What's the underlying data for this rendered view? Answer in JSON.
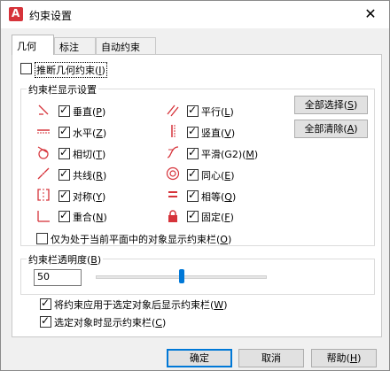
{
  "window": {
    "title": "约束设置",
    "close_glyph": "✕"
  },
  "tabs": [
    {
      "label": "几何",
      "active": true
    },
    {
      "label": "标注",
      "active": false
    },
    {
      "label": "自动约束",
      "active": false
    }
  ],
  "infer": {
    "label": "推断几何约束(",
    "key": "I",
    "tail": ")",
    "checked": false
  },
  "display_group": {
    "title": "约束栏显示设置"
  },
  "constraints_left": [
    {
      "label": "垂直(",
      "key": "P",
      "tail": ")",
      "icon": "perpendicular-icon",
      "checked": true
    },
    {
      "label": "水平(",
      "key": "Z",
      "tail": ")",
      "icon": "horizontal-icon",
      "checked": true
    },
    {
      "label": "相切(",
      "key": "T",
      "tail": ")",
      "icon": "tangent-icon",
      "checked": true
    },
    {
      "label": "共线(",
      "key": "R",
      "tail": ")",
      "icon": "collinear-icon",
      "checked": true
    },
    {
      "label": "对称(",
      "key": "Y",
      "tail": ")",
      "icon": "symmetric-icon",
      "checked": true
    },
    {
      "label": "重合(",
      "key": "N",
      "tail": ")",
      "icon": "coincident-icon",
      "checked": true
    }
  ],
  "constraints_right": [
    {
      "label": "平行(",
      "key": "L",
      "tail": ")",
      "icon": "parallel-icon",
      "checked": true
    },
    {
      "label": "竖直(",
      "key": "V",
      "tail": ")",
      "icon": "vertical-icon",
      "checked": true
    },
    {
      "label": "平滑(G2)(",
      "key": "M",
      "tail": ")",
      "icon": "smooth-icon",
      "checked": true
    },
    {
      "label": "同心(",
      "key": "E",
      "tail": ")",
      "icon": "concentric-icon",
      "checked": true
    },
    {
      "label": "相等(",
      "key": "Q",
      "tail": ")",
      "icon": "equal-icon",
      "checked": true
    },
    {
      "label": "固定(",
      "key": "F",
      "tail": ")",
      "icon": "fix-lock-icon",
      "checked": true
    }
  ],
  "buttons_side": {
    "select_all": "全部选择(",
    "select_all_key": "S",
    "clear_all": "全部清除(",
    "clear_all_key": "A",
    "tail": ")"
  },
  "only_current_plane": {
    "label": "仅为处于当前平面中的对象显示约束栏(",
    "key": "O",
    "tail": ")",
    "checked": false
  },
  "transparency": {
    "title": "约束栏透明度(",
    "key": "B",
    "tail": ")",
    "value": "50",
    "level_percent": 50
  },
  "show_after_apply": {
    "label": "将约束应用于选定对象后显示约束栏(",
    "key": "W",
    "tail": ")",
    "checked": true
  },
  "show_when_selected": {
    "label": "选定对象时显示约束栏(",
    "key": "C",
    "tail": ")",
    "checked": true
  },
  "footer": {
    "ok": "确定",
    "cancel": "取消",
    "help": "帮助(",
    "help_key": "H",
    "help_tail": ")"
  },
  "colors": {
    "icon_red": "#d6333a",
    "accent": "#0078d7"
  }
}
